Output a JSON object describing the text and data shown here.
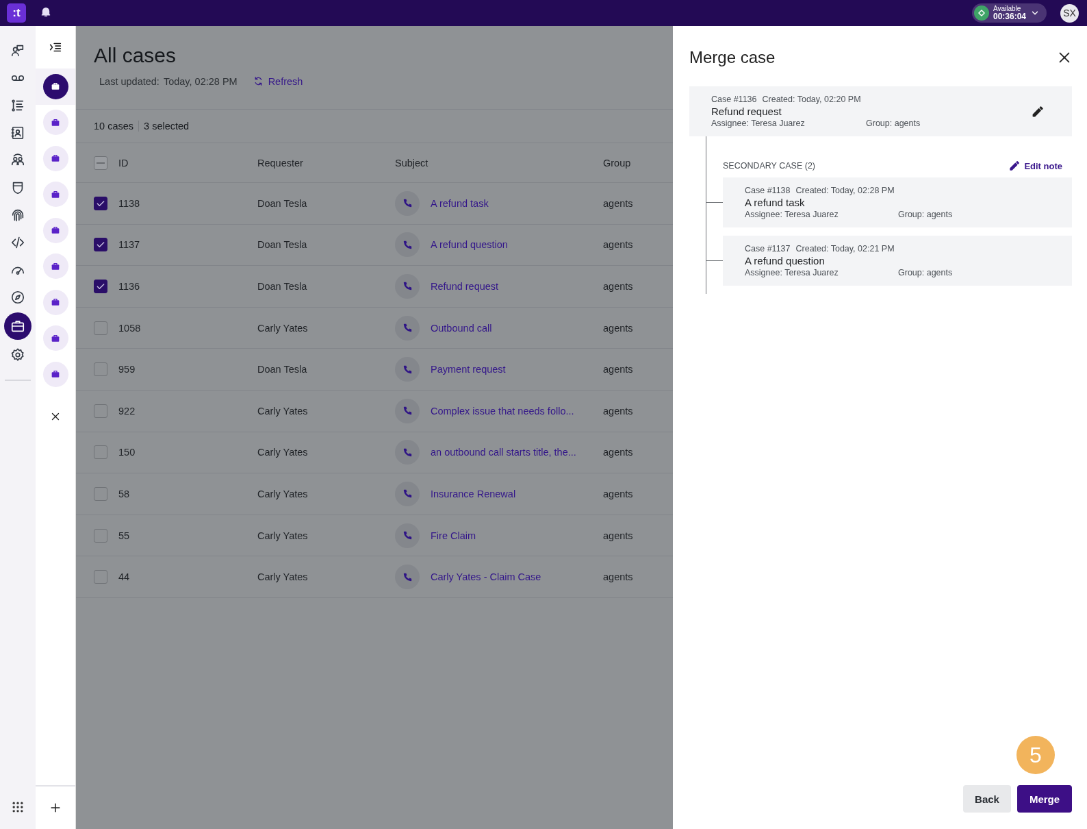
{
  "top_bar": {
    "logo": ":t",
    "status": {
      "label": "Available",
      "timer": "00:36:04"
    },
    "avatar": "SX"
  },
  "nav": [
    {
      "kind": "chat",
      "selected": false
    },
    {
      "kind": "voicemail",
      "selected": false
    },
    {
      "kind": "list",
      "selected": false
    },
    {
      "kind": "contacts",
      "selected": false
    },
    {
      "kind": "team",
      "selected": false
    },
    {
      "kind": "shield",
      "selected": false
    },
    {
      "kind": "fingerprint",
      "selected": false
    },
    {
      "kind": "code",
      "selected": false
    },
    {
      "kind": "gauge",
      "selected": false
    },
    {
      "kind": "compass",
      "selected": false
    },
    {
      "kind": "briefcase",
      "selected": true
    },
    {
      "kind": "gear",
      "selected": false
    }
  ],
  "case_tabs": [
    {
      "selected": true
    },
    {
      "selected": false
    },
    {
      "selected": false
    },
    {
      "selected": false
    },
    {
      "selected": false
    },
    {
      "selected": false
    },
    {
      "selected": false
    },
    {
      "selected": false
    },
    {
      "selected": false
    }
  ],
  "page": {
    "title": "All cases",
    "last_updated_label": "Last updated:",
    "last_updated": "Today, 02:28 PM",
    "refresh": "Refresh",
    "count": "10 cases",
    "selected_count": "3 selected"
  },
  "table": {
    "header_indeterminate": true,
    "columns": [
      "ID",
      "Requester",
      "Subject",
      "Group"
    ],
    "rows": [
      {
        "checked": true,
        "id": "1138",
        "requester": "Doan Tesla",
        "subject": "A refund task",
        "group": "agents"
      },
      {
        "checked": true,
        "id": "1137",
        "requester": "Doan Tesla",
        "subject": "A refund question",
        "group": "agents"
      },
      {
        "checked": true,
        "id": "1136",
        "requester": "Doan Tesla",
        "subject": "Refund request",
        "group": "agents"
      },
      {
        "checked": false,
        "id": "1058",
        "requester": "Carly Yates",
        "subject": "Outbound call",
        "group": "agents"
      },
      {
        "checked": false,
        "id": "959",
        "requester": "Doan Tesla",
        "subject": "Payment request",
        "group": "agents"
      },
      {
        "checked": false,
        "id": "922",
        "requester": "Carly Yates",
        "subject": "Complex issue that needs follo...",
        "group": "agents"
      },
      {
        "checked": false,
        "id": "150",
        "requester": "Carly Yates",
        "subject": "an outbound call starts title, the...",
        "group": "agents"
      },
      {
        "checked": false,
        "id": "58",
        "requester": "Carly Yates",
        "subject": "Insurance Renewal",
        "group": "agents"
      },
      {
        "checked": false,
        "id": "55",
        "requester": "Carly Yates",
        "subject": "Fire Claim",
        "group": "agents"
      },
      {
        "checked": false,
        "id": "44",
        "requester": "Carly Yates",
        "subject": "Carly Yates - Claim Case",
        "group": "agents"
      }
    ]
  },
  "merge_panel": {
    "title": "Merge case",
    "primary": {
      "case": "Case #1136",
      "created": "Created: Today, 02:20 PM",
      "subject": "Refund request",
      "assignee": "Assignee: Teresa Juarez",
      "group": "Group: agents"
    },
    "secondary_label": "SECONDARY CASE (2)",
    "edit_note": "Edit note",
    "secondary": [
      {
        "case": "Case #1138",
        "created": "Created: Today, 02:28 PM",
        "subject": "A refund task",
        "assignee": "Assignee: Teresa Juarez",
        "group": "Group: agents"
      },
      {
        "case": "Case #1137",
        "created": "Created: Today, 02:21 PM",
        "subject": "A refund question",
        "assignee": "Assignee: Teresa Juarez",
        "group": "Group: agents"
      }
    ],
    "step": "5",
    "back": "Back",
    "merge": "Merge"
  }
}
